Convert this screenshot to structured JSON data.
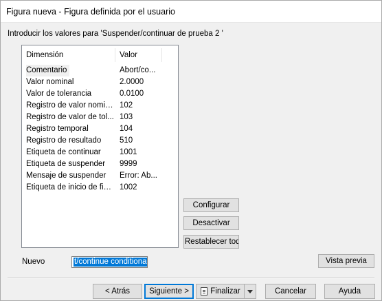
{
  "window": {
    "title": "Figura nueva - Figura definida por el usuario"
  },
  "intro_text": "Introducir los valores para 'Suspender/continuar de prueba 2 '",
  "table": {
    "columns": [
      "Dimensión",
      "Valor"
    ],
    "rows": [
      {
        "dimension": "Comentario",
        "valor": "Abort/co..."
      },
      {
        "dimension": "Valor nominal",
        "valor": "2.0000"
      },
      {
        "dimension": "Valor de tolerancia",
        "valor": "0.0100"
      },
      {
        "dimension": "Registro de valor nominal",
        "valor": "102"
      },
      {
        "dimension": "Registro de valor de tol...",
        "valor": "103"
      },
      {
        "dimension": "Registro temporal",
        "valor": "104"
      },
      {
        "dimension": "Registro de resultado",
        "valor": "510"
      },
      {
        "dimension": "Etiqueta de continuar",
        "valor": "1001"
      },
      {
        "dimension": "Etiqueta de suspender",
        "valor": "9999"
      },
      {
        "dimension": "Mensaje de suspender",
        "valor": "Error: Ab..."
      },
      {
        "dimension": "Etiqueta de inicio de figura",
        "valor": "1002"
      }
    ]
  },
  "side_buttons": {
    "configurar": "Configurar",
    "desactivar": "Desactivar",
    "restablecer": "Restablecer todo"
  },
  "nuevo": {
    "label": "Nuevo",
    "value": "t/continue conditional"
  },
  "vista_previa": "Vista previa",
  "footer": {
    "back": "< Atrás",
    "next": "Siguiente >",
    "finish": "Finalizar",
    "cancel": "Cancelar",
    "help": "Ayuda"
  }
}
